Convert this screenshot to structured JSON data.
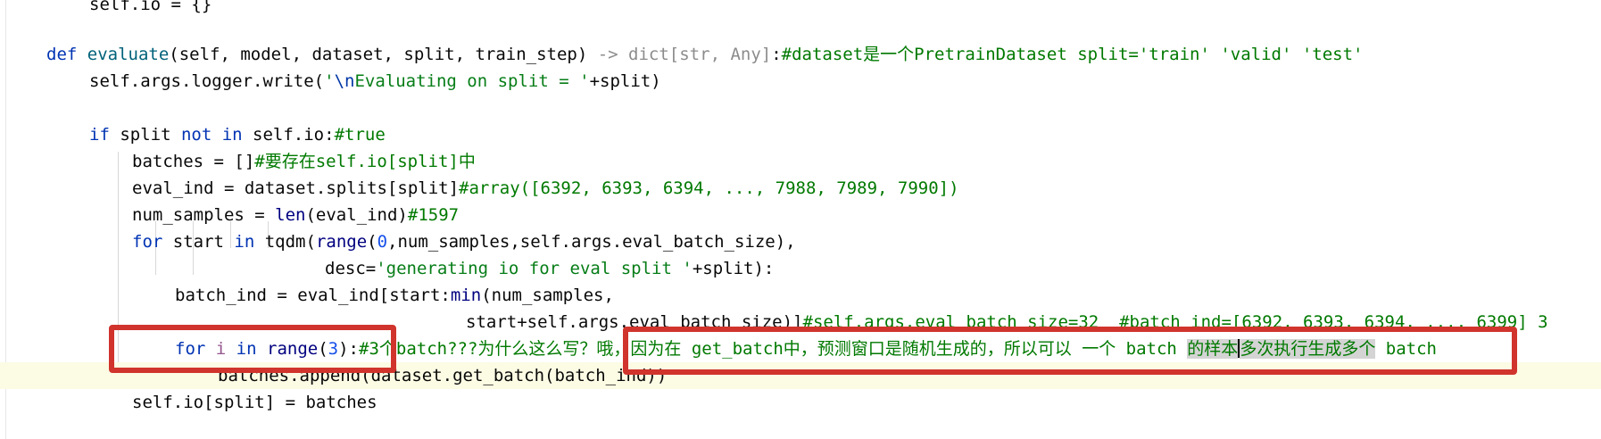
{
  "code_lines": {
    "l1": "self.io = {}",
    "l3_def": "def",
    "l3_fn": "evaluate",
    "l3_params": "(self, model, dataset, split, train_step) ",
    "l3_hint": "-> dict[str, Any]",
    "l3_colon": ":",
    "l3_comment": "#dataset是一个PretrainDataset split='train' 'valid' 'test'",
    "l4_pre": "self.args.logger.write(",
    "l4_str_q": "'",
    "l4_esc": "\\n",
    "l4_str": "Evaluating on split = '",
    "l4_post": "+split)",
    "l6_if": "if",
    "l6_mid": " split ",
    "l6_notin": "not in",
    "l6_post": " self.io:",
    "l6_comment": "#true",
    "l7_pre": "batches = []",
    "l7_comment": "#要存在self.io[split]中",
    "l8_pre": "eval_ind = dataset.splits[split]",
    "l8_comment": "#array([6392, 6393, 6394, ..., 7988, 7989, 7990])",
    "l9_pre": "num_samples = ",
    "l9_len": "len",
    "l9_post": "(eval_ind)",
    "l9_comment": "#1597",
    "l10_for": "for",
    "l10_a": " start ",
    "l10_in": "in",
    "l10_b": " tqdm(",
    "l10_range": "range",
    "l10_c": "(",
    "l10_zero": "0",
    "l10_d": ",num_samples,self.args.eval_batch_size),",
    "l11_pre": "desc=",
    "l11_str": "'generating io for eval split '",
    "l11_post": "+split):",
    "l12_pre": "batch_ind = eval_ind[start:",
    "l12_min": "min",
    "l12_post": "(num_samples,",
    "l13_pre": "start+self.args.eval_batch_size)]",
    "l13_comment": "#self.args.eval_batch_size=32  #batch_ind=[6392, 6393, 6394, ..., 6399] 3",
    "l14_for": "for",
    "l14_i": " i ",
    "l14_in": "in",
    "l14_sp": " ",
    "l14_range": "range",
    "l14_open": "(",
    "l14_three": "3",
    "l14_close": "):",
    "l14_comment": "#3个batch???为什么这么写？哦，因为在 get_batch中，预测窗口是随机生成的，所以可以 一个 batch ",
    "l14_hl1": "的样本",
    "l14_hl2": "多次执行生成多个",
    "l14_end": " batch",
    "l15": "batches.append(dataset.get_batch(batch_ind))",
    "l16": "self.io[split] = batches"
  }
}
